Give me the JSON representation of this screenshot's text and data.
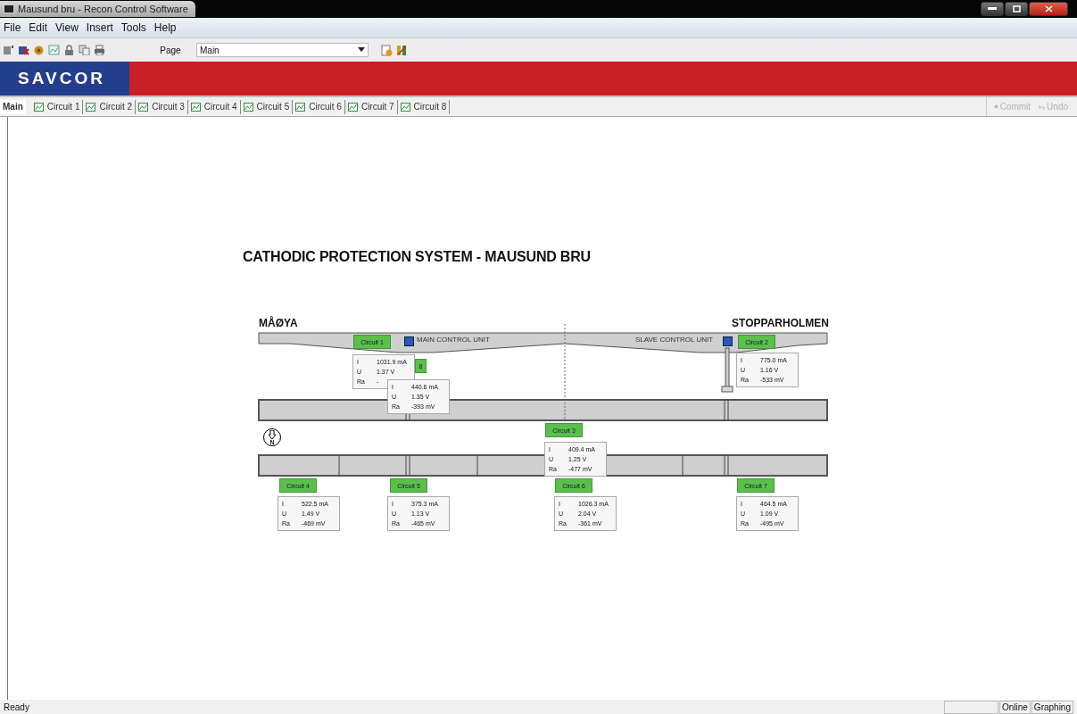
{
  "window": {
    "title": "Mausund bru - Recon Control Software"
  },
  "menu": [
    "File",
    "Edit",
    "View",
    "Insert",
    "Tools",
    "Help"
  ],
  "toolbar": {
    "page_label": "Page",
    "page_select": "Main"
  },
  "banner": {
    "logo": "SAVCOR"
  },
  "tabs": [
    {
      "label": "Main",
      "selected": true,
      "icon": false
    },
    {
      "label": "Circuit 1",
      "selected": false,
      "icon": true
    },
    {
      "label": "Circuit 2",
      "selected": false,
      "icon": true
    },
    {
      "label": "Circuit 3",
      "selected": false,
      "icon": true
    },
    {
      "label": "Circuit 4",
      "selected": false,
      "icon": true
    },
    {
      "label": "Circuit 5",
      "selected": false,
      "icon": true
    },
    {
      "label": "Circuit 6",
      "selected": false,
      "icon": true
    },
    {
      "label": "Circuit 7",
      "selected": false,
      "icon": true
    },
    {
      "label": "Circuit 8",
      "selected": false,
      "icon": true
    }
  ],
  "actions": [
    {
      "label": "Commit",
      "disabled": true
    },
    {
      "label": "Undo",
      "disabled": true
    }
  ],
  "diagram": {
    "title": "CATHODIC PROTECTION SYSTEM - MAUSUND BRU",
    "left_label": "MÅØYA",
    "right_label": "STOPPARHOLMEN",
    "main_unit": "MAIN CONTROL UNIT",
    "slave_unit": "SLAVE CONTROL UNIT",
    "north": "N",
    "circuits": [
      {
        "label": "Circuit 1",
        "rows": [
          [
            "I",
            "1031.9 mA"
          ],
          [
            "U",
            "1.37 V"
          ],
          [
            "Ra",
            "-"
          ]
        ]
      },
      {
        "label": "8",
        "rows": [
          [
            "I",
            "440.6 mA"
          ],
          [
            "U",
            "1.35 V"
          ],
          [
            "Ra",
            "-393 mV"
          ]
        ]
      },
      {
        "label": "Circuit 2",
        "rows": [
          [
            "I",
            "775.0 mA"
          ],
          [
            "U",
            "1.16 V"
          ],
          [
            "Ra",
            "-533 mV"
          ]
        ]
      },
      {
        "label": "Circuit 3",
        "rows": [
          [
            "I",
            "409.4 mA"
          ],
          [
            "U",
            "1.25 V"
          ],
          [
            "Ra",
            "-477 mV"
          ]
        ]
      },
      {
        "label": "Circuit 4",
        "rows": [
          [
            "I",
            "522.5 mA"
          ],
          [
            "U",
            "1.49 V"
          ],
          [
            "Ra",
            "-469 mV"
          ]
        ]
      },
      {
        "label": "Circuit 5",
        "rows": [
          [
            "I",
            "375.3 mA"
          ],
          [
            "U",
            "1.13 V"
          ],
          [
            "Ra",
            "-465 mV"
          ]
        ]
      },
      {
        "label": "Circuit 6",
        "rows": [
          [
            "I",
            "1026.3 mA"
          ],
          [
            "U",
            "2.04 V"
          ],
          [
            "Ra",
            "-361 mV"
          ]
        ]
      },
      {
        "label": "Circuit 7",
        "rows": [
          [
            "I",
            "464.5 mA"
          ],
          [
            "U",
            "1.09 V"
          ],
          [
            "Ra",
            "-495 mV"
          ]
        ]
      }
    ]
  },
  "status_bar": {
    "message": "Ready",
    "panels": [
      "Online",
      "Graphing"
    ]
  }
}
